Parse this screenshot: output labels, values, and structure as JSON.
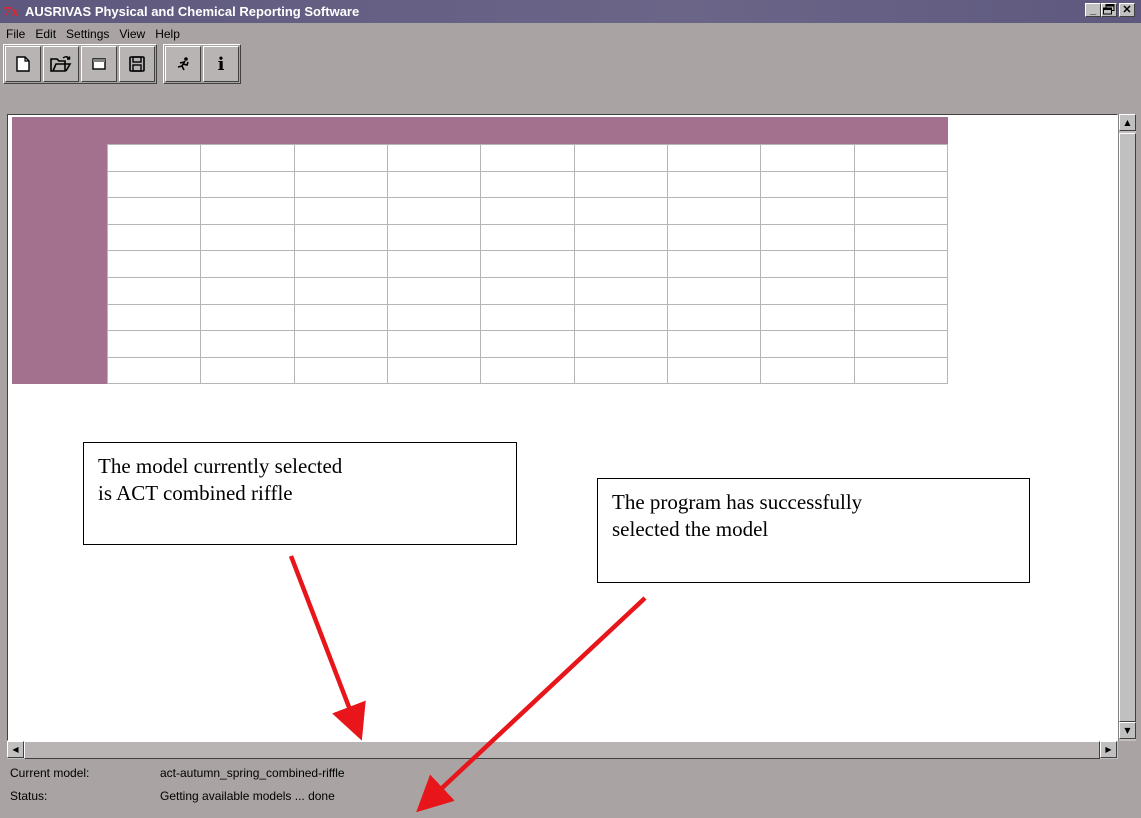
{
  "window": {
    "title": "AUSRIVAS Physical and Chemical Reporting Software",
    "icon": "app-icon",
    "controls": [
      "_",
      "ǲ",
      "X"
    ]
  },
  "menu": [
    "File",
    "Edit",
    "Settings",
    "View",
    "Help"
  ],
  "toolbar": {
    "buttons": [
      {
        "name": "new-file-icon"
      },
      {
        "name": "open-folder-icon"
      },
      {
        "name": "window-icon"
      },
      {
        "name": "save-disk-icon"
      },
      {
        "name": "run-icon"
      },
      {
        "name": "info-icon",
        "glyph": "i"
      }
    ]
  },
  "grid": {
    "rows": 9,
    "cols": 9,
    "header_color": "#a3718d"
  },
  "status": {
    "model_label": "Current model:",
    "model_value": "act-autumn_spring_combined-riffle",
    "status_label": "Status:",
    "status_value": "Getting available models ... done"
  },
  "annotations": {
    "callout1": {
      "line1": "The model currently selected",
      "line2": "is ACT combined riffle"
    },
    "callout2": {
      "line1": "The program has successfully",
      "line2": "selected the model"
    },
    "arrow_color": "#e8151b"
  }
}
